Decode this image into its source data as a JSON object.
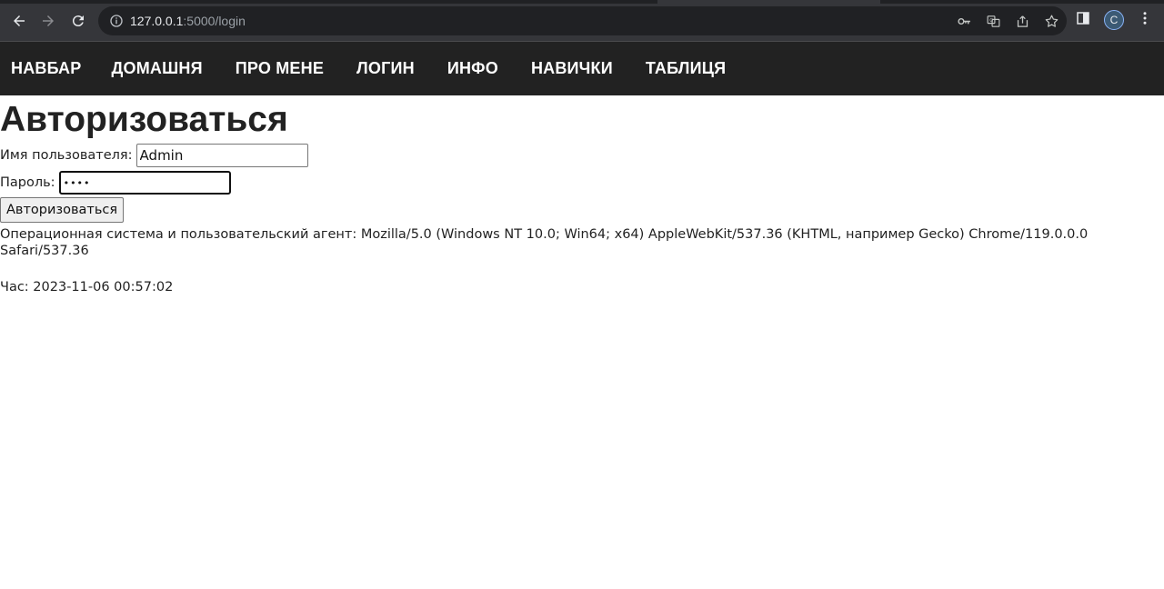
{
  "browser": {
    "url_host": "127.0.0.1",
    "url_rest": ":5000/login",
    "profile_initial": "C"
  },
  "navbar": {
    "brand": "НАВБАР",
    "items": [
      "ДОМАШНЯ",
      "ПРО МЕНЕ",
      "ЛОГИН",
      "ИНФО",
      "НАВИЧКИ",
      "ТАБЛИЦЯ"
    ]
  },
  "page": {
    "title": "Авторизоваться",
    "username_label": "Имя пользователя:",
    "username_value": "Admin",
    "password_label": "Пароль:",
    "password_value": "••••",
    "submit_label": "Авторизоваться",
    "user_agent_text": "Операционная система и пользовательский агент: Mozilla/5.0 (Windows NT 10.0; Win64; x64) AppleWebKit/537.36 (KHTML, например Gecko) Chrome/119.0.0.0 Safari/537.36",
    "time_text": "Час: 2023-11-06 00:57:02"
  }
}
